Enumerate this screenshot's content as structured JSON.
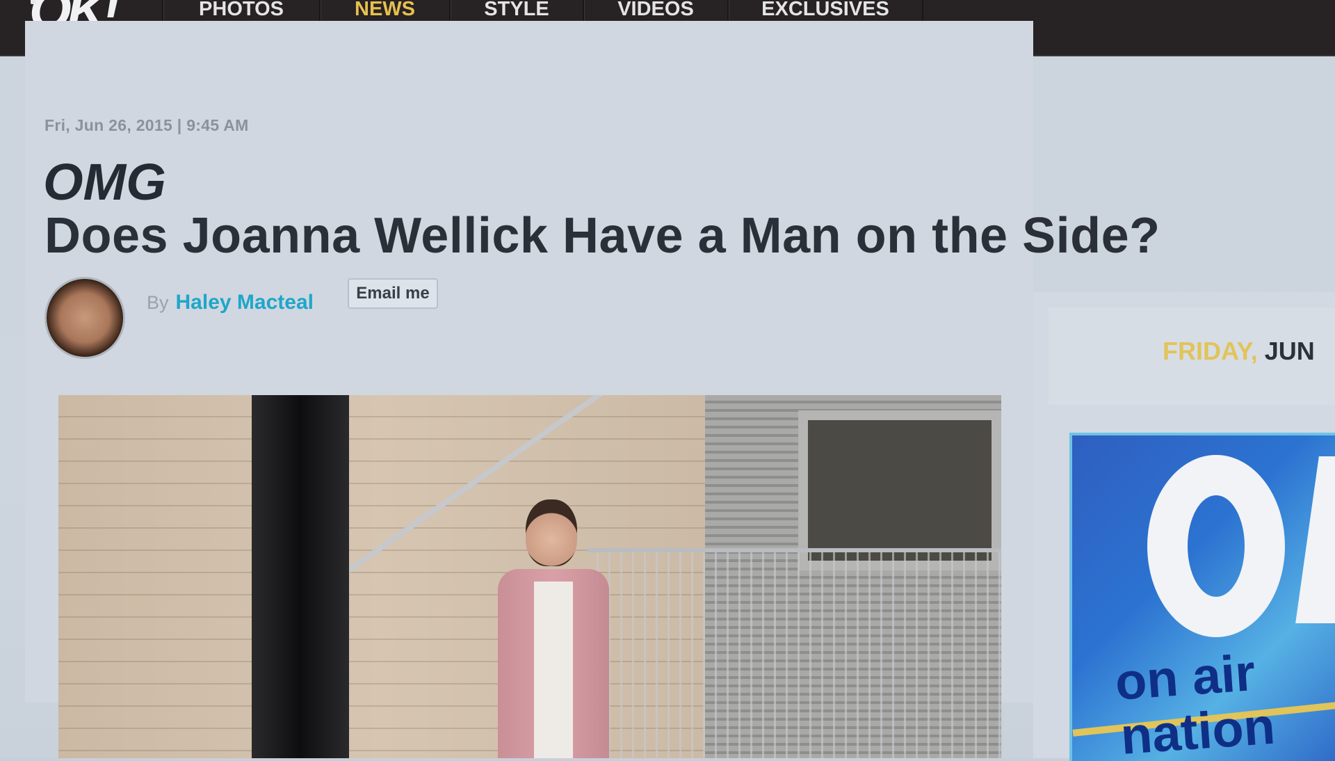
{
  "header": {
    "logo": "OK!",
    "nav": [
      {
        "label": "PHOTOS",
        "active": false
      },
      {
        "label": "NEWS",
        "active": true
      },
      {
        "label": "STYLE",
        "active": false
      },
      {
        "label": "VIDEOS",
        "active": false
      },
      {
        "label": "EXCLUSIVES",
        "active": false
      }
    ],
    "active_color": "#e6c04f"
  },
  "article": {
    "dateline": "Fri, Jun 26, 2015 | 9:45 AM",
    "kicker": "OMG",
    "headline": "Does Joanna Wellick Have a Man on the Side?",
    "byline_prefix": "By",
    "author": "Haley Macteal",
    "author_color": "#1fa6c9",
    "email_button": "Email me"
  },
  "sidebar": {
    "date_day": "FRIDAY,",
    "date_rest": "JUN",
    "promo_line1": "on air",
    "promo_line2": "nation"
  }
}
